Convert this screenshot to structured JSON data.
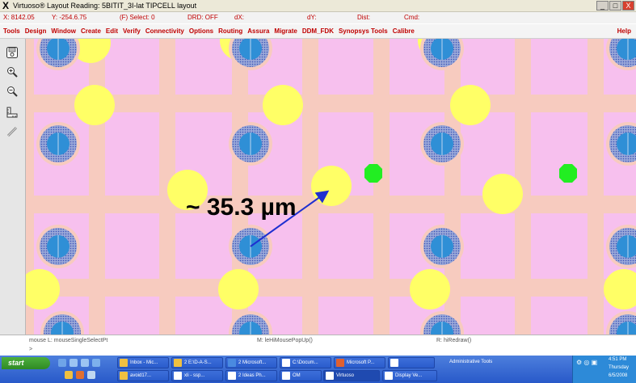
{
  "window": {
    "title": "Virtuoso® Layout Reading: 5BITIT_3I-lat TIPCELL layout",
    "buttons": {
      "minimize": "_",
      "maximize": "□",
      "close": "X"
    }
  },
  "statusbar": {
    "x": "X: 8142.05",
    "y": "Y: -254.6.75",
    "f": "(F) Select: 0",
    "drd": "DRD: OFF",
    "dx": "dX:",
    "dy": "dY:",
    "dist": "Dist:",
    "cmd": "Cmd:"
  },
  "menu": {
    "items": [
      "Tools",
      "Design",
      "Window",
      "Create",
      "Edit",
      "Verify",
      "Connectivity",
      "Options",
      "Routing",
      "Assura",
      "Migrate",
      "DDM_FDK",
      "Synopsys Tools",
      "Calibre"
    ],
    "help": "Help"
  },
  "toolbar": {
    "tools": [
      {
        "name": "save-tool",
        "icon": "floppy-icon"
      },
      {
        "name": "zoom-in-tool",
        "icon": "zoom-in-icon"
      },
      {
        "name": "zoom-out-tool",
        "icon": "zoom-out-icon"
      },
      {
        "name": "ruler-tool",
        "icon": "ruler-icon"
      },
      {
        "name": "pencil-tool",
        "icon": "pencil-icon"
      }
    ]
  },
  "layout": {
    "annotation": "~ 35.3 µm",
    "colors": {
      "background": "#f7c0ee",
      "trace": "#f7cbbf",
      "via_ring": "#7a8fc8",
      "via_core": "#2f8fd6",
      "yellow_pad": "#ffff66",
      "green_marker": "#22ee22",
      "arrow": "#1e2fd0"
    }
  },
  "cmdbar": {
    "left": "mouse L: mouseSingleSelectPt",
    "middle": "M: leHiMousePopUp()",
    "right": "R: hiRedraw()",
    "prompt": ">"
  },
  "taskbar": {
    "start": "start",
    "buttons": [
      {
        "label": "Inbox - Mic...",
        "color": "#f0c040"
      },
      {
        "label": "2 E:\\D-A-S...",
        "color": "#f0c040"
      },
      {
        "label": "2 Microsoft...",
        "color": "#4a8ae0"
      },
      {
        "label": "C:\\Docum...",
        "color": "#ffffff"
      },
      {
        "label": "Microsoft P...",
        "color": "#e06030"
      },
      {
        "label": "",
        "color": "#ffffff"
      },
      {
        "label": "avoid17...",
        "color": "#f0c040"
      },
      {
        "label": "xli - ssp...",
        "color": "#ffffff"
      },
      {
        "label": "2 Ideas Ph...",
        "color": "#ffffff"
      },
      {
        "label": "OM",
        "color": "#ffffff"
      },
      {
        "label": "Virtuoso",
        "color": "#ffffff"
      },
      {
        "label": "Display Ve...",
        "color": "#ffffff"
      }
    ],
    "admin_tools": "Administrative Tools",
    "tray": {
      "time": "4:51 PM",
      "day": "Thursday",
      "date": "6/5/2008"
    }
  }
}
